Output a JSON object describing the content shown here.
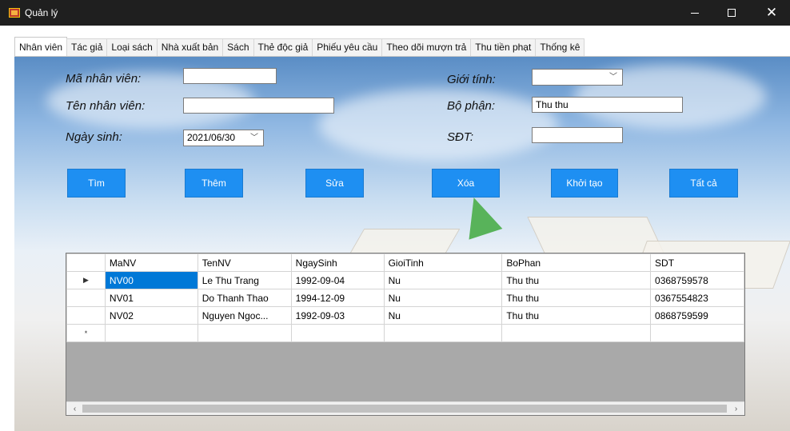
{
  "window": {
    "title": "Quản lý"
  },
  "tabs": [
    {
      "label": "Nhân viên",
      "active": true
    },
    {
      "label": "Tác giả"
    },
    {
      "label": "Loại sách"
    },
    {
      "label": "Nhà xuất bản"
    },
    {
      "label": "Sách"
    },
    {
      "label": "Thẻ độc giả"
    },
    {
      "label": "Phiếu yêu cầu"
    },
    {
      "label": "Theo dõi mượn trả"
    },
    {
      "label": "Thu tiền phạt"
    },
    {
      "label": "Thống kê"
    }
  ],
  "form": {
    "ma_label": "Mã nhân viên:",
    "ma_value": "",
    "ten_label": "Tên nhân viên:",
    "ten_value": "",
    "ngay_label": "Ngày sinh:",
    "ngay_value": "2021/06/30",
    "gioi_label": "Giới tính:",
    "gioi_value": "",
    "bophan_label": "Bộ phận:",
    "bophan_value": "Thu thu",
    "sdt_label": "SĐT:",
    "sdt_value": ""
  },
  "buttons": {
    "tim": "Tìm",
    "them": "Thêm",
    "sua": "Sửa",
    "xoa": "Xóa",
    "khoitao": "Khởi tạo",
    "tatca": "Tất cả"
  },
  "grid": {
    "columns": [
      "MaNV",
      "TenNV",
      "NgaySinh",
      "GioiTinh",
      "BoPhan",
      "SDT"
    ],
    "rows": [
      [
        "NV00",
        "Le Thu Trang",
        "1992-09-04",
        "Nu",
        "Thu thu",
        "0368759578"
      ],
      [
        "NV01",
        "Do Thanh Thao",
        "1994-12-09",
        "Nu",
        "Thu thu",
        "0367554823"
      ],
      [
        "NV02",
        "Nguyen Ngoc...",
        "1992-09-03",
        "Nu",
        "Thu thu",
        "0868759599"
      ]
    ],
    "current_row_marker": "▶",
    "new_row_marker": "*"
  },
  "icons": {
    "app": "app-window-icon",
    "minimize": "minimize-icon",
    "maximize": "maximize-icon",
    "close": "close-icon",
    "dropdown": "chevron-down-icon",
    "scroll_left": "scroll-left-icon",
    "scroll_right": "scroll-right-icon"
  }
}
